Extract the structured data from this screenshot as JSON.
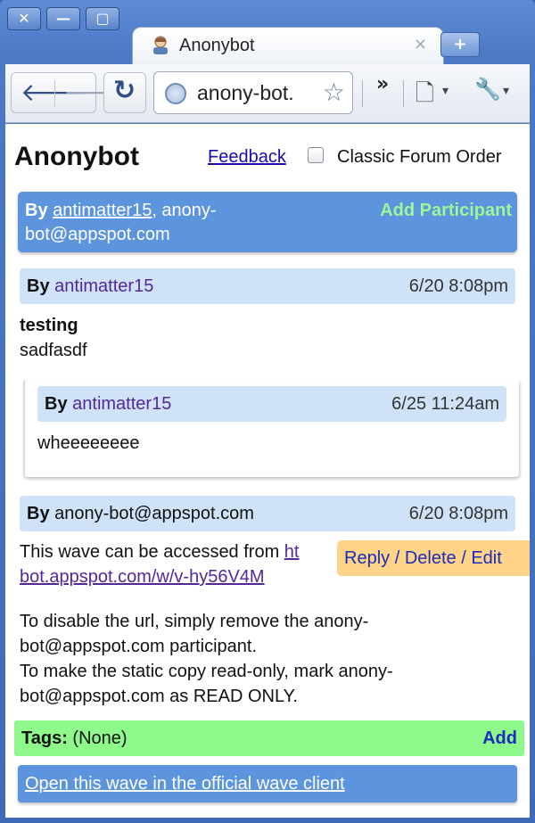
{
  "window": {
    "close_glyph": "✕",
    "minimize_glyph": "—",
    "maximize_glyph": "▢"
  },
  "tab": {
    "title": "Anonybot",
    "close_glyph": "×",
    "favicon": "robot-face-icon"
  },
  "new_tab_glyph": "+",
  "toolbar": {
    "back_glyph": "🡐",
    "forward_glyph": "🡒",
    "reload_glyph": "↻",
    "url": "anony-bot.",
    "star_glyph": "☆",
    "overflow_glyph": "»",
    "page_menu_glyph": "🗋",
    "wrench_glyph": "🔧",
    "dropdown_glyph": "▾"
  },
  "header": {
    "title": "Anonybot",
    "feedback": "Feedback",
    "classic_order_label": "Classic Forum Order",
    "classic_order_checked": false
  },
  "participants": {
    "by_label": "By",
    "user1": "antimatter15",
    "sep": ", anony-",
    "line2": "bot@appspot.com",
    "add_label": "Add Participant"
  },
  "blips": [
    {
      "by_label": "By",
      "author": "antimatter15",
      "time": "6/20 8:08pm",
      "title": "testing",
      "body": "sadfasdf"
    },
    {
      "by_label": "By",
      "author": "antimatter15",
      "time": "6/25 11:24am",
      "body": "wheeeeeeee"
    },
    {
      "by_label": "By",
      "author": "anony-bot@appspot.com",
      "time": "6/20 8:08pm",
      "line1_prefix": "This wave can be accessed from ",
      "line1_link": "ht",
      "line2_link": "bot.appspot.com/w/v-hy56V4M",
      "para2_l1": "To disable the url, simply remove the anony-",
      "para2_l2": "bot@appspot.com participant.",
      "para2_l3": "To make the static copy read-only, mark anony-",
      "para2_l4": "bot@appspot.com as READ ONLY."
    }
  ],
  "actions": {
    "reply": "Reply",
    "delete": "Delete",
    "edit": "Edit",
    "sep": "/"
  },
  "tags": {
    "label": "Tags:",
    "value": "(None)",
    "add": "Add"
  },
  "open_link": "Open this wave in the official wave client",
  "colors": {
    "frame": "#4c79c6",
    "blue_bar": "#5c95dd",
    "light_bar": "#cfe2f7",
    "tags_bar": "#8ef98a",
    "actions_bg": "#ffd489",
    "author_purple": "#55289a"
  }
}
